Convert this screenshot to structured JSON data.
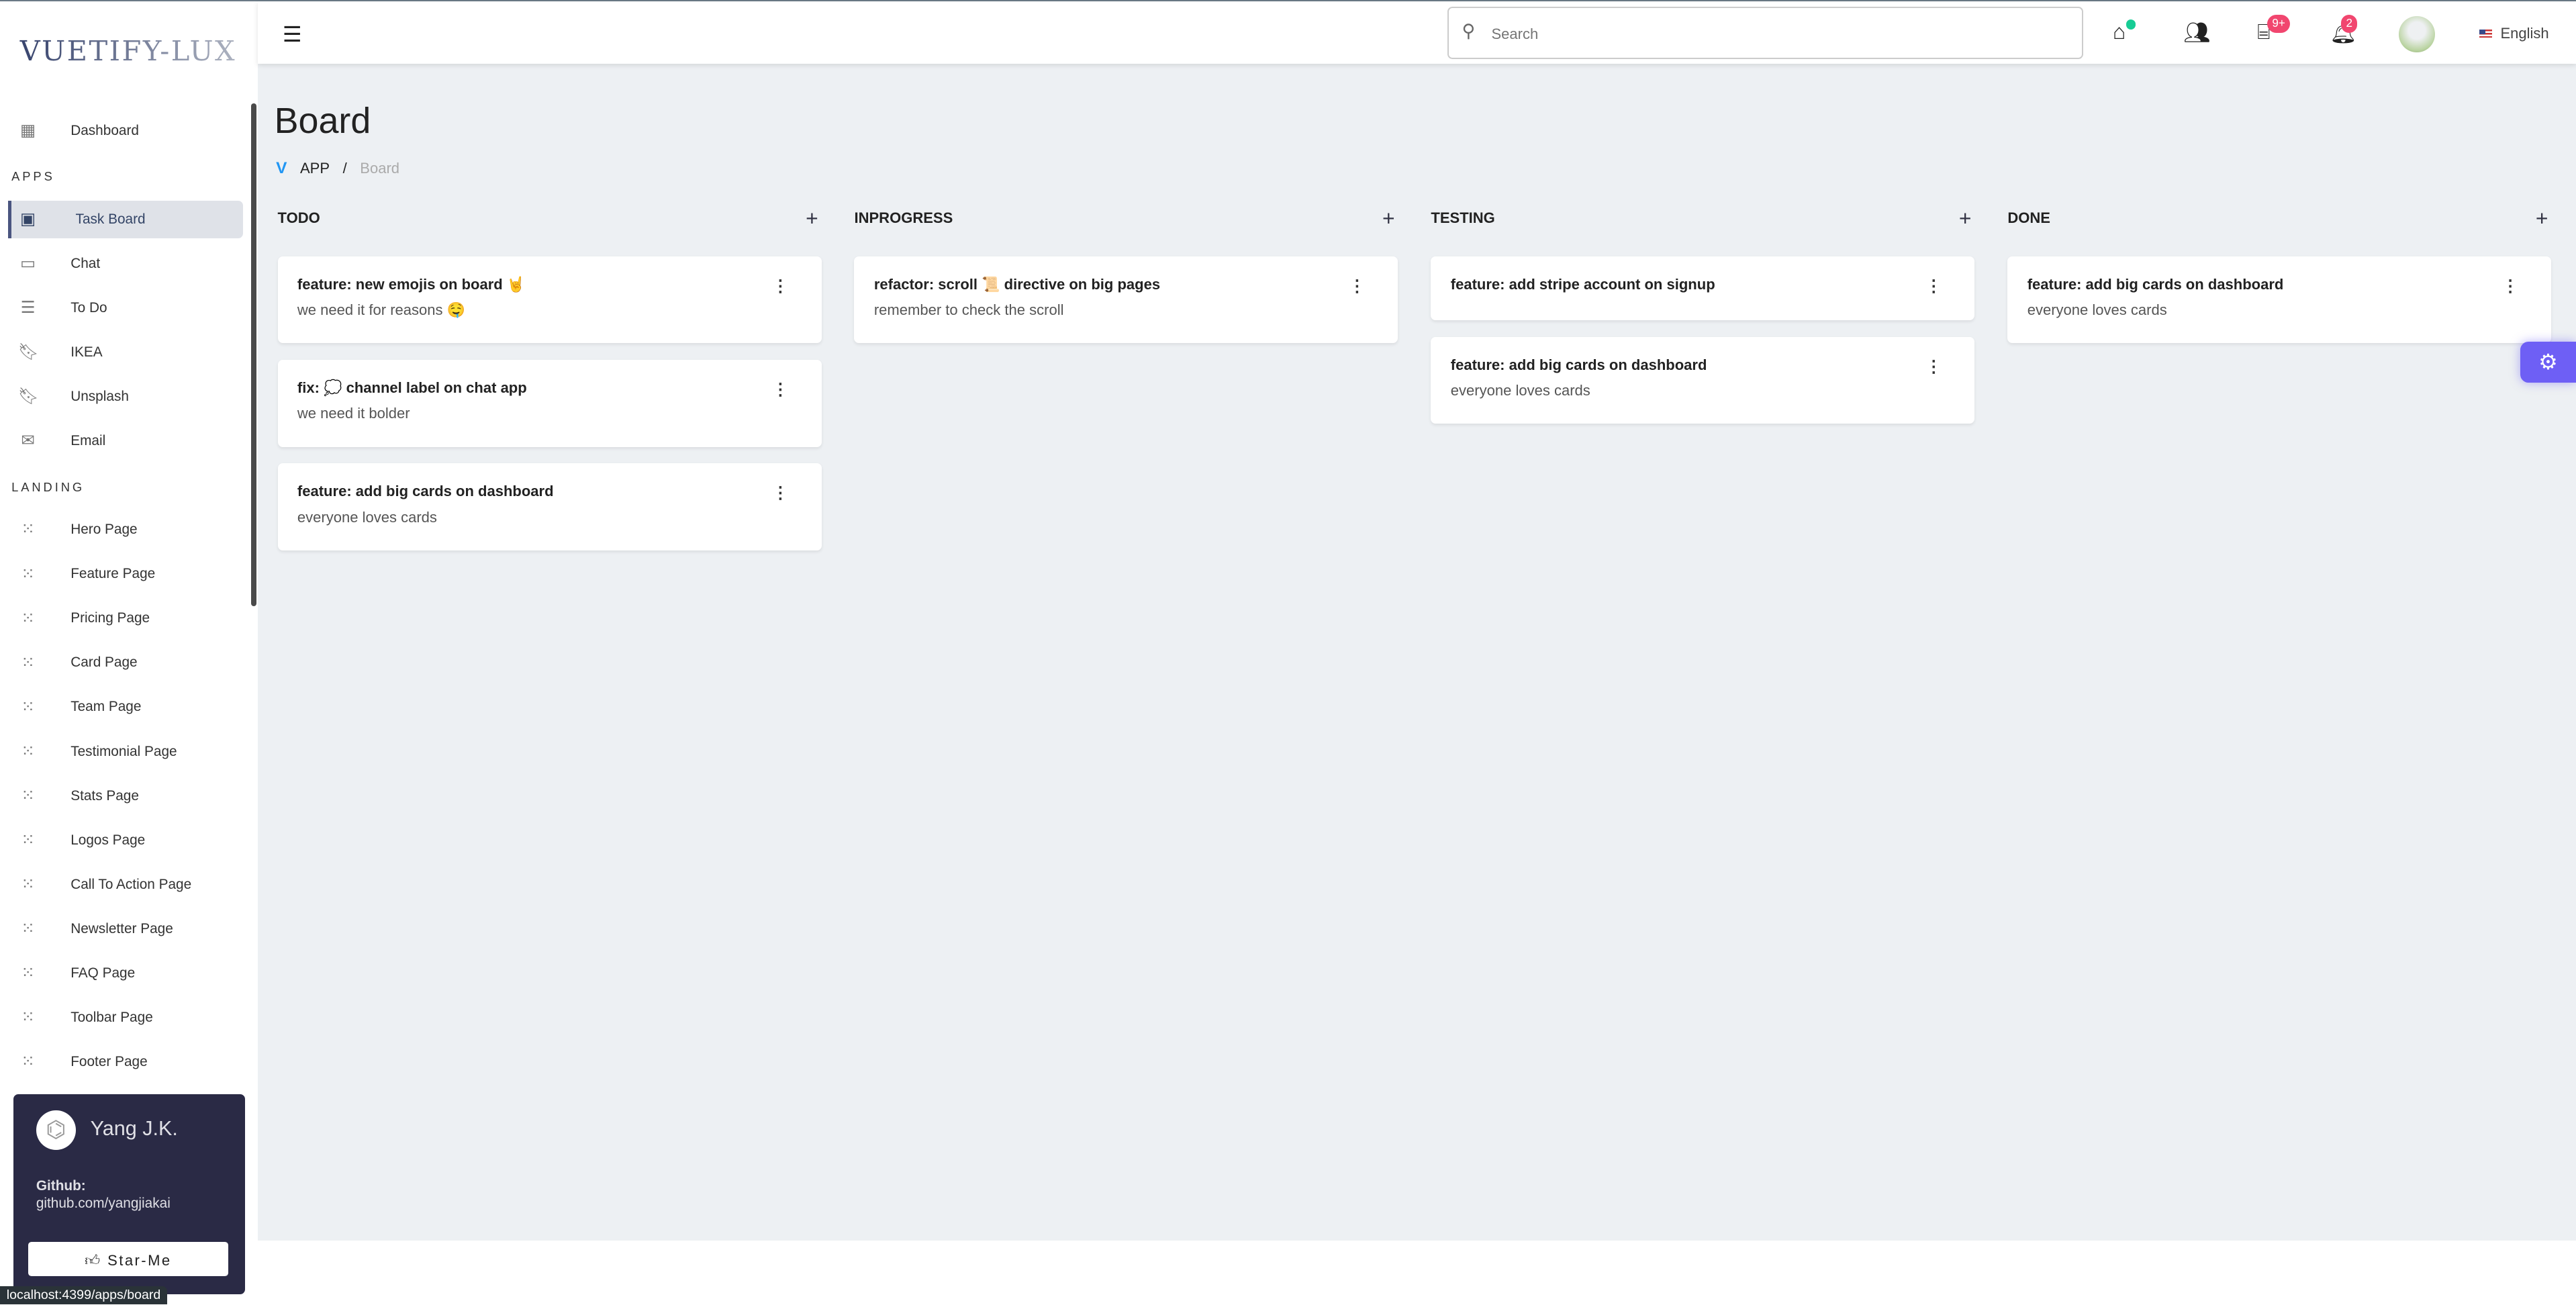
{
  "sidebar": {
    "logo": "VUETIFY-LUX",
    "dashboard": {
      "label": "Dashboard",
      "icon": "dashboard-icon"
    },
    "apps_heading": "APPS",
    "apps": [
      {
        "label": "Task Board",
        "icon": "task-board-icon",
        "active": true
      },
      {
        "label": "Chat",
        "icon": "chat-icon"
      },
      {
        "label": "To Do",
        "icon": "list-icon"
      },
      {
        "label": "IKEA",
        "icon": "bookmark-plus-icon"
      },
      {
        "label": "Unsplash",
        "icon": "bookmark-plus-icon"
      },
      {
        "label": "Email",
        "icon": "email-icon"
      }
    ],
    "landing_heading": "LANDING",
    "landing": [
      "Hero Page",
      "Feature Page",
      "Pricing Page",
      "Card Page",
      "Team Page",
      "Testimonial Page",
      "Stats Page",
      "Logos Page",
      "Call To Action Page",
      "Newsletter Page",
      "FAQ Page",
      "Toolbar Page",
      "Footer Page"
    ],
    "profile": {
      "name": "Yang J.K.",
      "github_label": "Github:",
      "github_url": "github.com/yangjiakai",
      "button": "Star-Me"
    }
  },
  "status_url": "localhost:4399/apps/board",
  "header": {
    "search_placeholder": "Search",
    "store_badge": "9+",
    "notification_badge": "2",
    "language": "English",
    "home_dot_color": "#17cc95",
    "badge_color": "#f1466f"
  },
  "page": {
    "title": "Board",
    "breadcrumb": [
      "APP",
      "Board"
    ]
  },
  "columns": [
    {
      "title": "TODO",
      "cards": [
        {
          "title": "feature: new emojis on board 🤘",
          "desc": "we need it for reasons 🤤"
        },
        {
          "title": "fix: 💭 channel label on chat app",
          "desc": "we need it bolder"
        },
        {
          "title": "feature: add big cards on dashboard",
          "desc": "everyone loves cards"
        }
      ]
    },
    {
      "title": "INPROGRESS",
      "cards": [
        {
          "title": "refactor: scroll 📜 directive on big pages",
          "desc": "remember to check the scroll"
        }
      ]
    },
    {
      "title": "TESTING",
      "cards": [
        {
          "title": "feature: add stripe account on signup",
          "desc": ""
        },
        {
          "title": "feature: add big cards on dashboard",
          "desc": "everyone loves cards"
        }
      ]
    },
    {
      "title": "DONE",
      "cards": [
        {
          "title": "feature: add big cards on dashboard",
          "desc": "everyone loves cards"
        }
      ]
    }
  ],
  "settings_color": "#6e5ff5"
}
